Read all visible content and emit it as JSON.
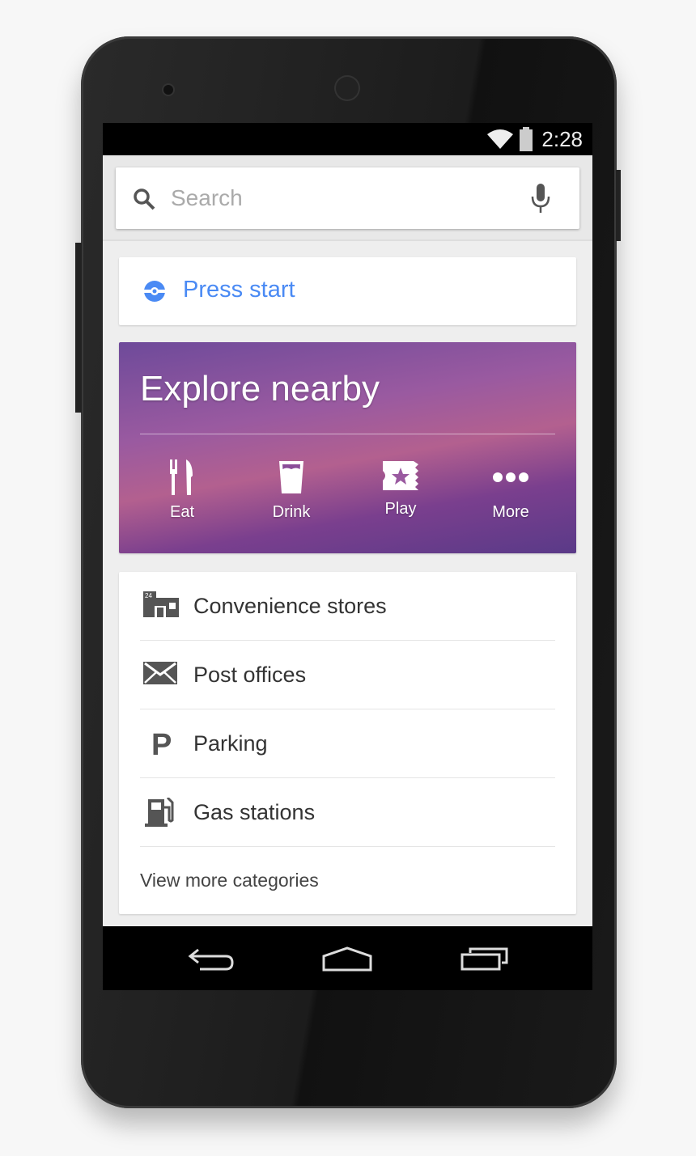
{
  "status_bar": {
    "time": "2:28"
  },
  "search": {
    "placeholder": "Search"
  },
  "press_start": {
    "label": "Press start",
    "color": "#4a8af4"
  },
  "explore": {
    "title": "Explore nearby",
    "options": [
      {
        "label": "Eat",
        "icon": "fork-knife-icon"
      },
      {
        "label": "Drink",
        "icon": "glass-icon"
      },
      {
        "label": "Play",
        "icon": "ticket-star-icon"
      },
      {
        "label": "More",
        "icon": "more-dots-icon"
      }
    ]
  },
  "categories": {
    "items": [
      {
        "label": "Convenience stores",
        "icon": "store-24-icon"
      },
      {
        "label": "Post offices",
        "icon": "envelope-icon"
      },
      {
        "label": "Parking",
        "icon": "parking-icon"
      },
      {
        "label": "Gas stations",
        "icon": "gas-pump-icon"
      }
    ],
    "view_more": "View more categories"
  }
}
